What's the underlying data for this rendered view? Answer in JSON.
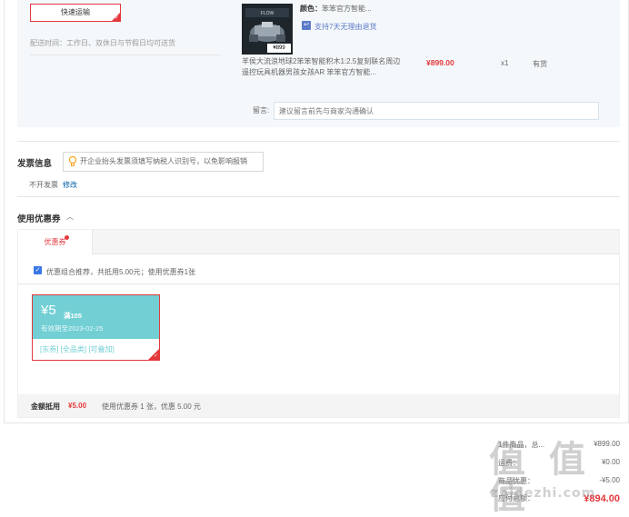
{
  "shipping": {
    "method_label": "快速运输",
    "delivery_time": "配送时间：工作日、双休日与节假日均可送货"
  },
  "product": {
    "thumb_price": "¥899",
    "color_label": "颜色：",
    "color_value": "笨笨官方智能...",
    "return_policy": "支持7天无理由退货",
    "title": "羊侯大流浪地球2笨笨智能积木1:2.5复刻联名周边遥控玩具机器男孩女孩AR 笨笨官方智能...",
    "price": "¥899.00",
    "qty": "x1",
    "stock": "有货",
    "memo_label": "留言:",
    "memo_placeholder": "建议留言前先与商家沟通确认"
  },
  "invoice": {
    "title": "发票信息",
    "tip": "开企业抬头发票须填写纳税人识别号，以免影响报销",
    "status": "不开发票",
    "edit_link": "修改"
  },
  "coupons": {
    "title": "使用优惠券",
    "tab_label": "优惠券",
    "recommend_text": "优惠组合推荐，共抵用5.00元；使用优惠券1张",
    "card": {
      "amount": "¥5",
      "condition": "满105",
      "expiry": "有效期至2023-02-25",
      "tags": "[东券]  [全品类]  [可叠加]"
    },
    "footer_label": "金额抵用",
    "footer_amount": "¥5.00",
    "footer_desc": "使用优惠券 1 张，优惠 5.00 元"
  },
  "summary": {
    "rows": [
      {
        "key": "1件商品，总...",
        "value": "¥899.00"
      },
      {
        "key": "运费：",
        "value": "¥0.00"
      },
      {
        "key": "商品优惠：",
        "value": "-¥5.00"
      },
      {
        "key": "应付总额：",
        "value": "¥894.00"
      }
    ]
  },
  "watermark": {
    "main": "值 值 值",
    "sub": "zhidezhi.com"
  }
}
